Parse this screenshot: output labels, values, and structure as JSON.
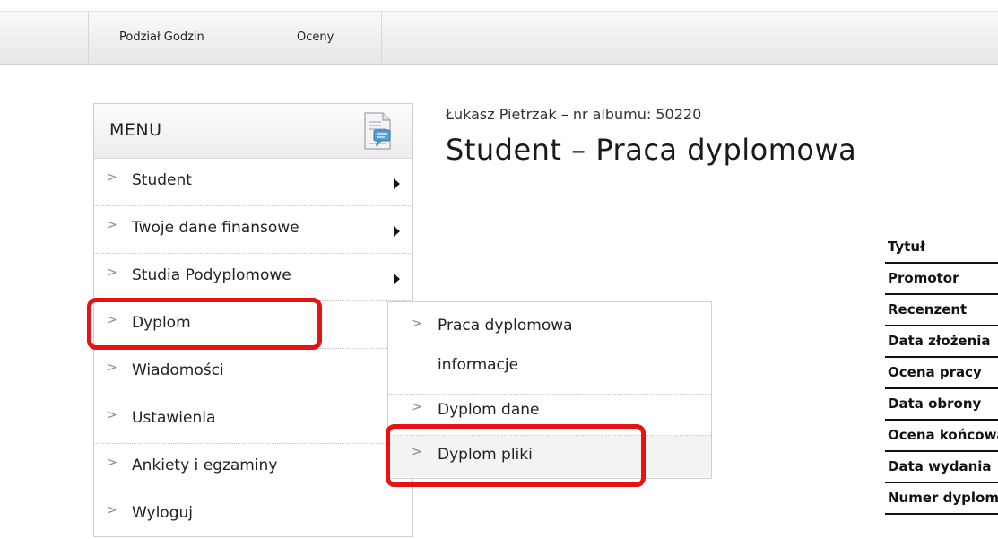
{
  "topnav": {
    "items": [
      {
        "label": "Podział Godzin"
      },
      {
        "label": "Oceny"
      }
    ]
  },
  "menu": {
    "title": "MENU",
    "icon": "document-chat-icon",
    "items": [
      {
        "label": "Student",
        "has_submenu": true
      },
      {
        "label": "Twoje dane finansowe",
        "has_submenu": true
      },
      {
        "label": "Studia Podyplomowe",
        "has_submenu": true
      },
      {
        "label": "Dyplom",
        "has_submenu": true
      },
      {
        "label": "Wiadomości",
        "has_submenu": true
      },
      {
        "label": "Ustawienia",
        "has_submenu": true
      },
      {
        "label": "Ankiety i egzaminy",
        "has_submenu": true
      },
      {
        "label": "Wyloguj",
        "has_submenu": false
      }
    ],
    "bullet": ">"
  },
  "submenu": {
    "items": [
      {
        "label_line1": "Praca dyplomowa",
        "label_line2": "informacje"
      },
      {
        "label_line1": "Dyplom dane"
      },
      {
        "label_line1": "Dyplom pliki"
      }
    ]
  },
  "content": {
    "student_info": "Łukasz Pietrzak – nr albumu: 50220",
    "page_title": "Student – Praca dyplomowa",
    "table_rows": [
      "Tytuł",
      "Promotor",
      "Recenzent",
      "Data złożenia",
      "Ocena pracy",
      "Data obrony",
      "Ocena końcowa",
      "Data wydania",
      "Numer dyplomu"
    ]
  },
  "colors": {
    "highlight": "#e41414",
    "topbar": "#eeeeee"
  }
}
